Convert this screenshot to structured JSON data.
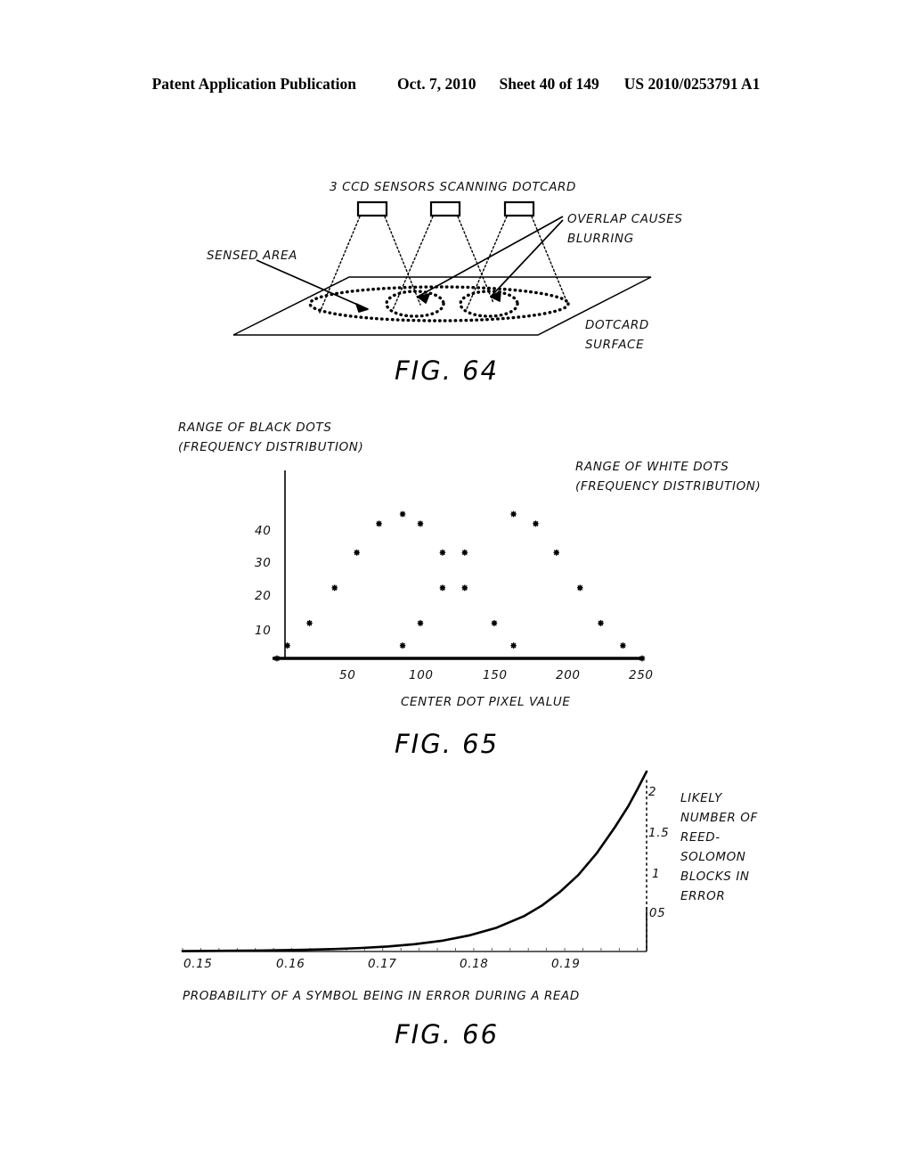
{
  "header": {
    "publication": "Patent Application Publication",
    "date": "Oct. 7, 2010",
    "sheet": "Sheet 40 of 149",
    "docnum": "US 2010/0253791 A1"
  },
  "fig64": {
    "caption": "FIG. 64",
    "title": "3 CCD SENSORS SCANNING DOTCARD",
    "label_sensed_area": "SENSED AREA",
    "label_overlap_line1": "OVERLAP CAUSES",
    "label_overlap_line2": "BLURRING",
    "label_dotcard_line1": "DOTCARD",
    "label_dotcard_line2": "SURFACE",
    "sensor_count": 3
  },
  "fig65": {
    "caption": "FIG. 65",
    "label_black_line1": "RANGE OF BLACK DOTS",
    "label_black_line2": "(FREQUENCY DISTRIBUTION)",
    "label_white_line1": "RANGE OF WHITE DOTS",
    "label_white_line2": "(FREQUENCY DISTRIBUTION)",
    "xlabel": "CENTER DOT PIXEL VALUE"
  },
  "fig66": {
    "caption": "FIG. 66",
    "xlabel": "PROBABILITY OF A SYMBOL BEING IN ERROR DURING A READ",
    "ylabel_l1": "LIKELY",
    "ylabel_l2": "NUMBER OF",
    "ylabel_l3": "REED-",
    "ylabel_l4": "SOLOMON",
    "ylabel_l5": "BLOCKS IN",
    "ylabel_l6": "ERROR"
  },
  "chart_data": [
    {
      "type": "scatter",
      "title": "FIG. 65",
      "xlabel": "CENTER DOT PIXEL VALUE",
      "ylabel": "RANGE OF BLACK DOTS (FREQUENCY DISTRIBUTION)",
      "xlim": [
        0,
        250
      ],
      "ylim": [
        0,
        48
      ],
      "xticks": [
        50,
        100,
        150,
        200,
        250
      ],
      "xticklabels": [
        "50",
        "100",
        "150",
        "200",
        "250"
      ],
      "yticks": [
        10,
        20,
        30,
        40
      ],
      "yticklabels": [
        "10",
        "20",
        "30",
        "40"
      ],
      "grid": false,
      "legend": null,
      "annotations": [
        "RANGE OF BLACK DOTS (FREQUENCY DISTRIBUTION)",
        "RANGE OF WHITE DOTS (FREQUENCY DISTRIBUTION)"
      ],
      "series": [
        {
          "name": "RANGE OF BLACK DOTS",
          "points": [
            [
              3,
              0
            ],
            [
              10,
              4
            ],
            [
              25,
              11
            ],
            [
              42,
              22
            ],
            [
              57,
              33
            ],
            [
              72,
              42
            ],
            [
              88,
              45
            ],
            [
              88,
              4
            ],
            [
              100,
              42
            ],
            [
              100,
              11
            ],
            [
              115,
              33
            ],
            [
              115,
              22
            ]
          ]
        },
        {
          "name": "RANGE OF WHITE DOTS",
          "points": [
            [
              130,
              33
            ],
            [
              130,
              22
            ],
            [
              150,
              11
            ],
            [
              163,
              45
            ],
            [
              163,
              4
            ],
            [
              178,
              42
            ],
            [
              192,
              33
            ],
            [
              208,
              22
            ],
            [
              222,
              11
            ],
            [
              237,
              4
            ],
            [
              250,
              0
            ]
          ]
        }
      ]
    },
    {
      "type": "line",
      "title": "FIG. 66",
      "xlabel": "PROBABILITY OF A SYMBOL BEING IN ERROR DURING A READ",
      "ylabel": "LIKELY NUMBER OF REED-SOLOMON BLOCKS IN ERROR",
      "xlim": [
        0.1465,
        0.1975
      ],
      "ylim": [
        0,
        2.35
      ],
      "xticks": [
        0.15,
        0.16,
        0.17,
        0.18,
        0.19
      ],
      "xticklabels": [
        "0.15",
        "0.16",
        "0.17",
        "0.18",
        "0.19"
      ],
      "yticks": [
        0.05,
        1,
        1.5,
        2
      ],
      "yticklabels": [
        ".05",
        "1",
        "1.5",
        "2"
      ],
      "yaxis_position": "right",
      "grid": false,
      "series": [
        {
          "name": "likely-blocks-in-error",
          "x": [
            0.1465,
            0.15,
            0.155,
            0.16,
            0.163,
            0.166,
            0.169,
            0.172,
            0.175,
            0.178,
            0.181,
            0.184,
            0.186,
            0.188,
            0.19,
            0.192,
            0.194,
            0.1955,
            0.1965,
            0.1975
          ],
          "y": [
            0.005,
            0.008,
            0.013,
            0.022,
            0.031,
            0.045,
            0.065,
            0.095,
            0.14,
            0.21,
            0.31,
            0.46,
            0.6,
            0.78,
            1.0,
            1.28,
            1.62,
            1.9,
            2.12,
            2.35
          ]
        }
      ]
    }
  ]
}
